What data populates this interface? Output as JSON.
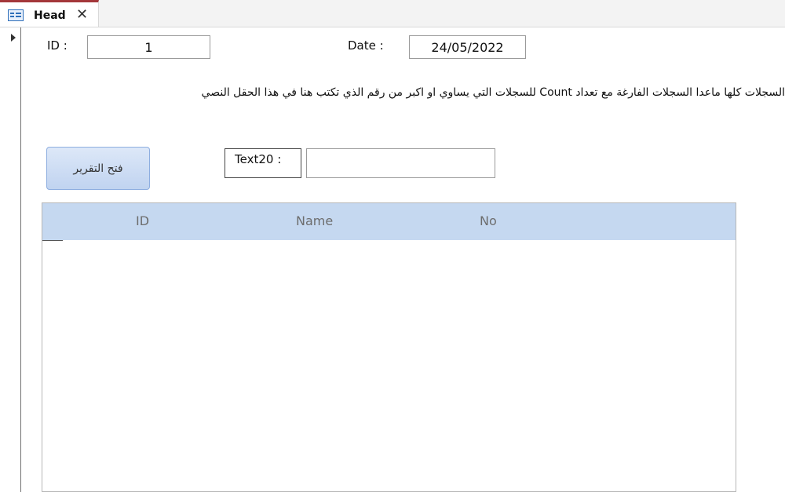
{
  "tab": {
    "title": "Head",
    "close": "✕"
  },
  "form": {
    "id_label": "ID :",
    "id_value": "1",
    "date_label": "Date :",
    "date_value": "24/05/2022",
    "note": "السجلات كلها ماعدا السجلات الفارغة مع تعداد Count  للسجلات التي يساوي او اكبر من رقم الذي تكتب هنا في هذا الحقل النصي",
    "open_report_button": "فتح التقرير",
    "text20_label": "Text20 :",
    "text20_value": ""
  },
  "subform": {
    "columns": [
      "ID",
      "Name",
      "No"
    ]
  },
  "colors": {
    "tab_accent": "#a4373a",
    "header_bg": "#c5d8f0",
    "button_bg": "#c0d3f0"
  }
}
